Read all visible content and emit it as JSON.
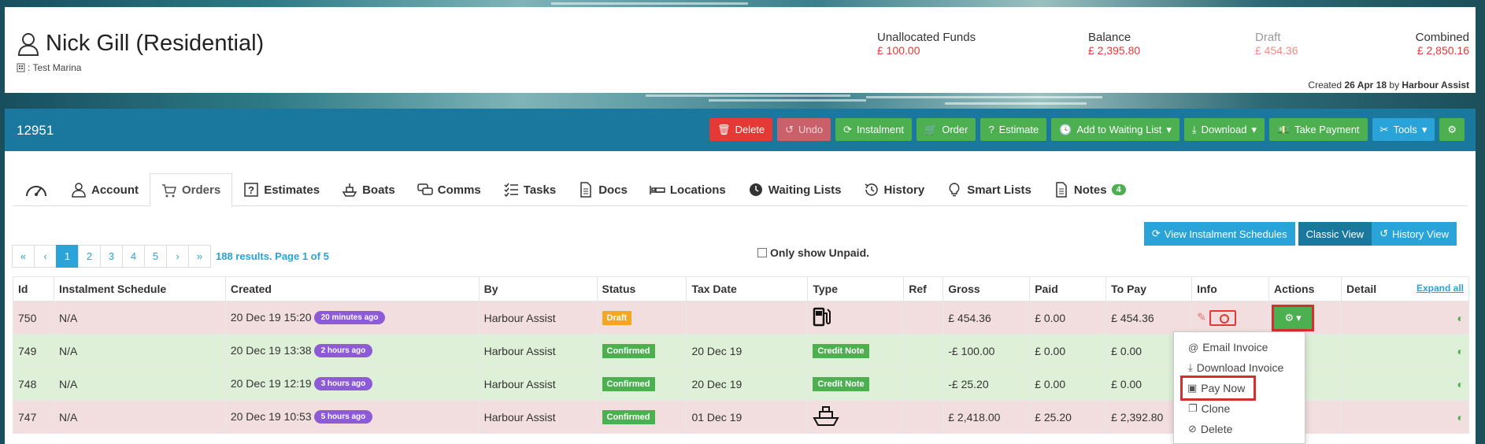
{
  "customer": {
    "name": "Nick Gill (Residential)",
    "marina": ": Test Marina",
    "funds": [
      {
        "label": "Unallocated Funds",
        "value": "£ 100.00"
      },
      {
        "label": "Balance",
        "value": "£ 2,395.80"
      },
      {
        "label": "Draft",
        "value": "£ 454.36"
      },
      {
        "label": "Combined",
        "value": "£ 2,850.16"
      }
    ],
    "created_prefix": "Created",
    "created_date": "26 Apr 18",
    "created_by_prefix": "by",
    "created_by": "Harbour Assist"
  },
  "order_bar": {
    "order_number": "12951",
    "buttons": {
      "delete": "Delete",
      "undo": "Undo",
      "instalment": "Instalment",
      "order": "Order",
      "estimate": "Estimate",
      "waiting_list": "Add to Waiting List",
      "download": "Download",
      "take_payment": "Take Payment",
      "tools": "Tools"
    }
  },
  "tabs": [
    {
      "label": ""
    },
    {
      "label": "Account"
    },
    {
      "label": "Orders"
    },
    {
      "label": "Estimates"
    },
    {
      "label": "Boats"
    },
    {
      "label": "Comms"
    },
    {
      "label": "Tasks"
    },
    {
      "label": "Docs"
    },
    {
      "label": "Locations"
    },
    {
      "label": "Waiting Lists"
    },
    {
      "label": "History"
    },
    {
      "label": "Smart Lists"
    },
    {
      "label": "Notes",
      "badge": "4"
    }
  ],
  "views": {
    "instalment_schedules": "View Instalment Schedules",
    "classic": "Classic View",
    "history": "History View"
  },
  "pagination": {
    "first": "«",
    "prev": "‹",
    "pages": [
      "1",
      "2",
      "3",
      "4",
      "5"
    ],
    "next": "›",
    "last": "»",
    "info": "188 results. Page 1 of 5"
  },
  "filter": {
    "only_unpaid": "Only show Unpaid."
  },
  "table": {
    "headers": {
      "id": "Id",
      "schedule": "Instalment Schedule",
      "created": "Created",
      "by": "By",
      "status": "Status",
      "tax_date": "Tax Date",
      "type": "Type",
      "ref": "Ref",
      "gross": "Gross",
      "paid": "Paid",
      "to_pay": "To Pay",
      "info": "Info",
      "actions": "Actions",
      "detail": "Detail",
      "expand_all": "Expand all"
    },
    "rows": [
      {
        "id": "750",
        "schedule": "N/A",
        "created": "20 Dec 19 15:20",
        "ago": "20 minutes ago",
        "by": "Harbour Assist",
        "status": "Draft",
        "tax_date": "",
        "type_icon": "fuel-pump-icon",
        "gross": "£ 454.36",
        "paid": "£ 0.00",
        "to_pay": "£ 454.36"
      },
      {
        "id": "749",
        "schedule": "N/A",
        "created": "20 Dec 19 13:38",
        "ago": "2 hours ago",
        "by": "Harbour Assist",
        "status": "Confirmed",
        "tax_date": "20 Dec 19",
        "type_label": "Credit Note",
        "gross": "-£ 100.00",
        "paid": "£ 0.00",
        "to_pay": "£ 0.00"
      },
      {
        "id": "748",
        "schedule": "N/A",
        "created": "20 Dec 19 12:19",
        "ago": "3 hours ago",
        "by": "Harbour Assist",
        "status": "Confirmed",
        "tax_date": "20 Dec 19",
        "type_label": "Credit Note",
        "gross": "-£ 25.20",
        "paid": "£ 0.00",
        "to_pay": "£ 0.00"
      },
      {
        "id": "747",
        "schedule": "N/A",
        "created": "20 Dec 19 10:53",
        "ago": "5 hours ago",
        "by": "Harbour Assist",
        "status": "Confirmed",
        "tax_date": "01 Dec 19",
        "type_icon": "boat-icon",
        "gross": "£ 2,418.00",
        "paid": "£ 25.20",
        "to_pay": "£ 2,392.80"
      }
    ]
  },
  "dropdown": {
    "items": [
      {
        "label": "Email Invoice",
        "icon": "at-icon"
      },
      {
        "label": "Download Invoice",
        "icon": "download-icon"
      },
      {
        "label": "Pay Now",
        "icon": "money-icon"
      },
      {
        "label": "Clone",
        "icon": "copy-icon"
      },
      {
        "label": "Delete",
        "icon": "ban-icon"
      }
    ]
  },
  "colors": {
    "accent": "#29a3d8",
    "bar": "#1a779e",
    "green": "#4caf50",
    "red": "#e53935",
    "pill": "#8e5bd6"
  }
}
